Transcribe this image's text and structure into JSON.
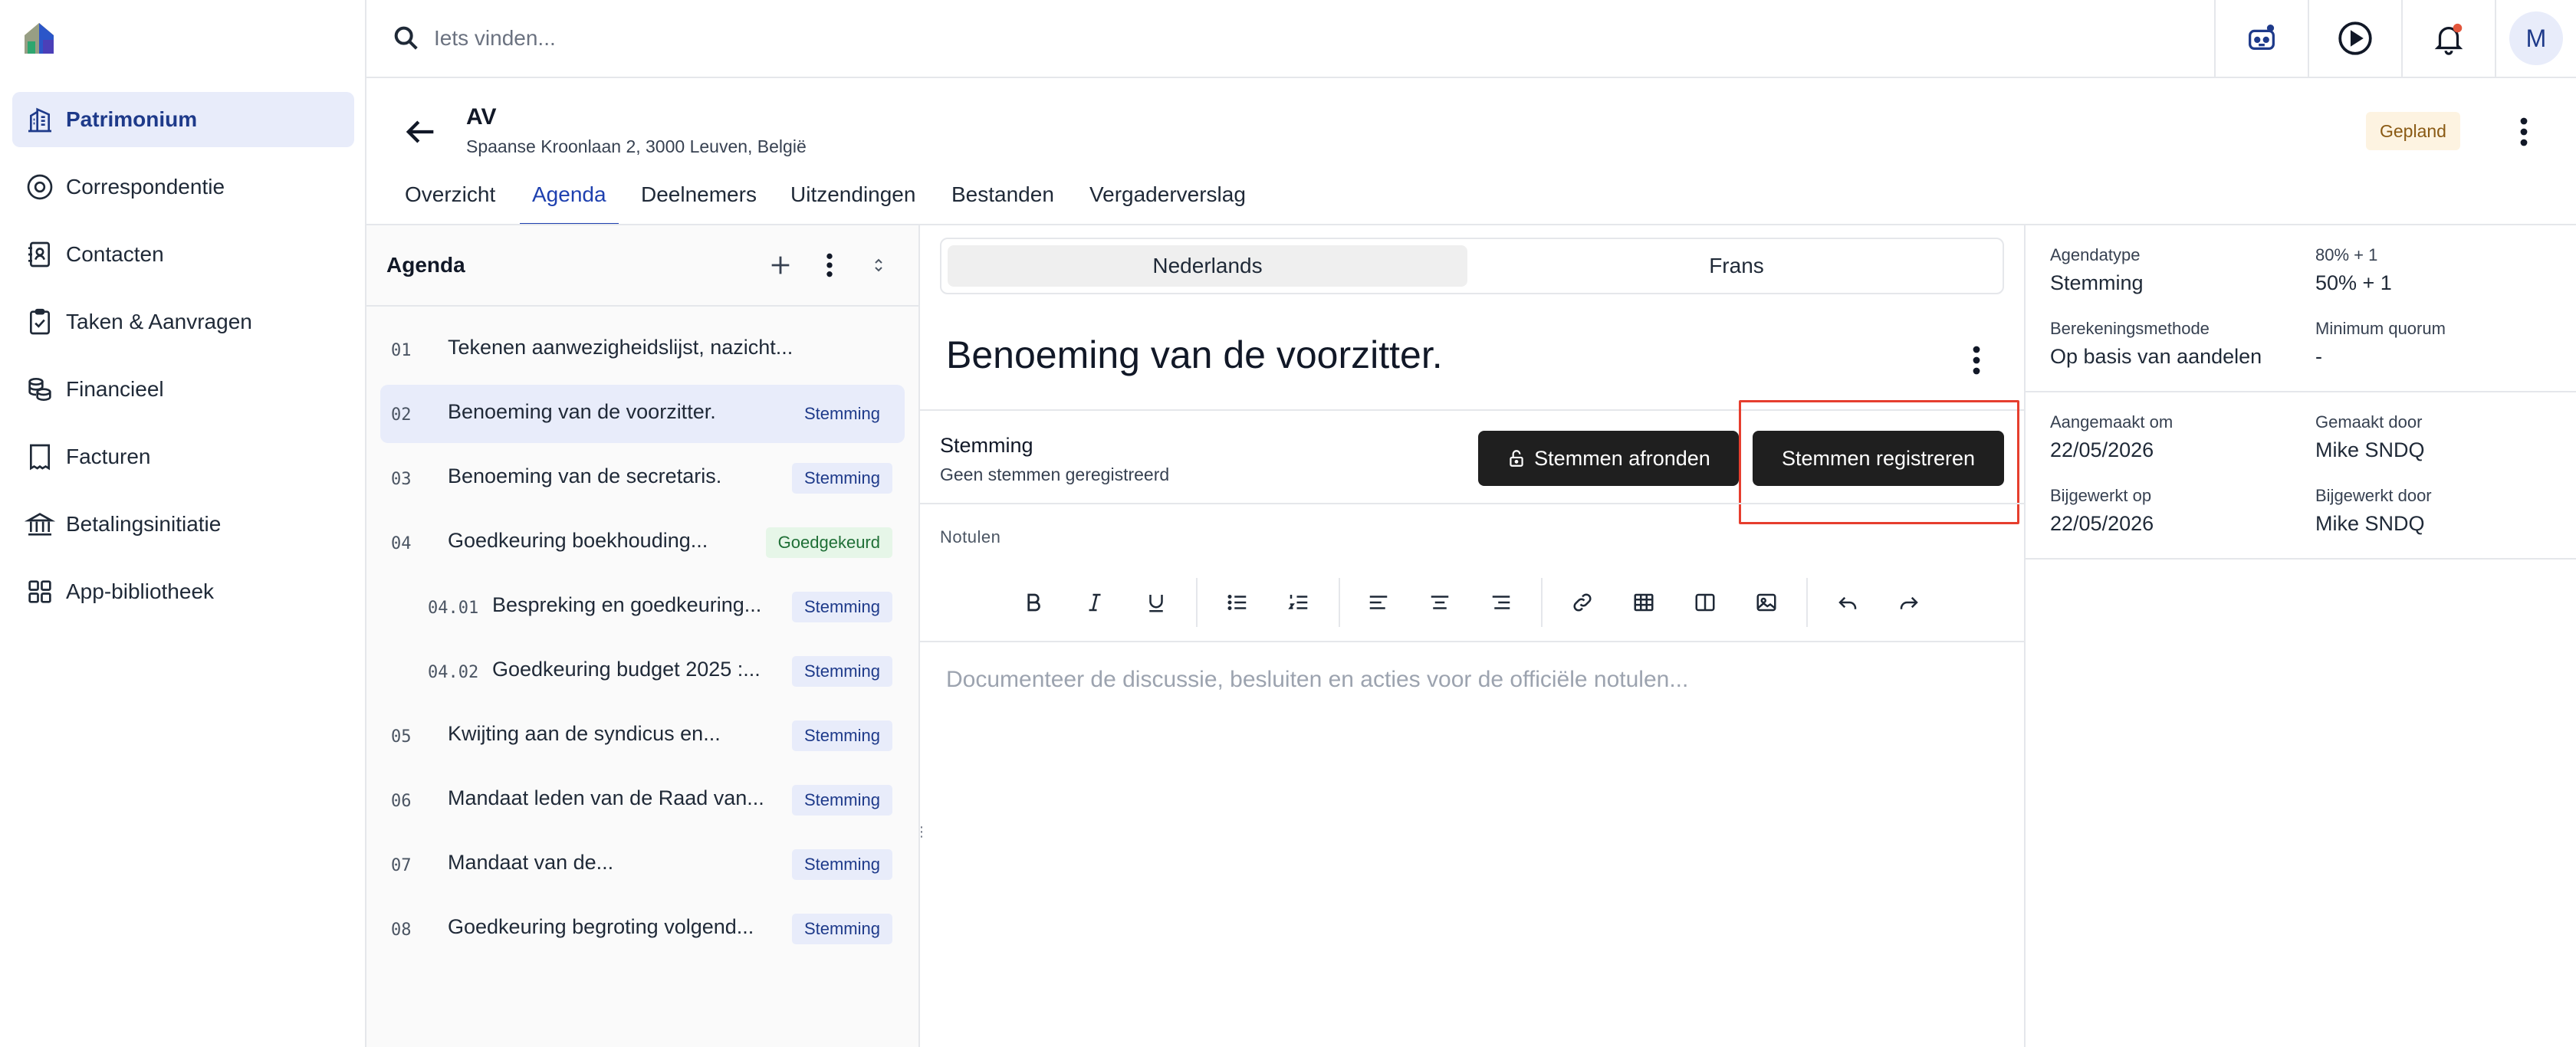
{
  "search": {
    "placeholder": "Iets vinden..."
  },
  "sidebar": {
    "items": [
      {
        "label": "Patrimonium",
        "icon": "building-icon"
      },
      {
        "label": "Correspondentie",
        "icon": "at-sign-icon"
      },
      {
        "label": "Contacten",
        "icon": "contact-book-icon"
      },
      {
        "label": "Taken & Aanvragen",
        "icon": "clipboard-check-icon"
      },
      {
        "label": "Financieel",
        "icon": "coins-icon"
      },
      {
        "label": "Facturen",
        "icon": "invoice-icon"
      },
      {
        "label": "Betalingsinitiatie",
        "icon": "bank-icon"
      },
      {
        "label": "App-bibliotheek",
        "icon": "apps-grid-icon"
      }
    ]
  },
  "topbar": {
    "avatar_initial": "M"
  },
  "header": {
    "title": "AV",
    "address": "Spaanse Kroonlaan 2, 3000 Leuven, België",
    "status": "Gepland"
  },
  "tabs": [
    {
      "label": "Overzicht"
    },
    {
      "label": "Agenda"
    },
    {
      "label": "Deelnemers"
    },
    {
      "label": "Uitzendingen"
    },
    {
      "label": "Bestanden"
    },
    {
      "label": "Vergaderverslag"
    }
  ],
  "agenda": {
    "heading": "Agenda",
    "items": [
      {
        "num": "01",
        "text": "Tekenen aanwezigheidslijst, nazicht...",
        "badge": ""
      },
      {
        "num": "02",
        "text": "Benoeming van de voorzitter.",
        "badge": "Stemming"
      },
      {
        "num": "03",
        "text": "Benoeming van de secretaris.",
        "badge": "Stemming"
      },
      {
        "num": "04",
        "text": "Goedkeuring boekhouding...",
        "badge": "Goedgekeurd"
      },
      {
        "num": "04.01",
        "text": "Bespreking en goedkeuring...",
        "badge": "Stemming"
      },
      {
        "num": "04.02",
        "text": "Goedkeuring budget 2025 :...",
        "badge": "Stemming"
      },
      {
        "num": "05",
        "text": "Kwijting aan de syndicus en...",
        "badge": "Stemming"
      },
      {
        "num": "06",
        "text": "Mandaat leden van de Raad van...",
        "badge": "Stemming"
      },
      {
        "num": "07",
        "text": "Mandaat van de...",
        "badge": "Stemming"
      },
      {
        "num": "08",
        "text": "Goedkeuring begroting volgend...",
        "badge": "Stemming"
      }
    ]
  },
  "detail": {
    "lang_nl": "Nederlands",
    "lang_fr": "Frans",
    "title": "Benoeming van de voorzitter.",
    "vote_label": "Stemming",
    "vote_sub": "Geen stemmen geregistreerd",
    "btn_finish": "Stemmen afronden",
    "btn_register": "Stemmen registreren",
    "notes_label": "Notulen",
    "notes_placeholder": "Documenteer de discussie, besluiten en acties voor de officiële notulen..."
  },
  "meta": {
    "agendatype_label": "Agendatype",
    "agendatype_value": "Stemming",
    "majority_label": "80% + 1",
    "majority_value": "50% + 1",
    "method_label": "Berekeningsmethode",
    "method_value": "Op basis van aandelen",
    "quorum_label": "Minimum quorum",
    "quorum_value": "-",
    "created_label": "Aangemaakt om",
    "created_value": "22/05/2026",
    "created_by_label": "Gemaakt door",
    "created_by_value": "Mike SNDQ",
    "updated_label": "Bijgewerkt op",
    "updated_value": "22/05/2026",
    "updated_by_label": "Bijgewerkt door",
    "updated_by_value": "Mike SNDQ"
  },
  "colors": {
    "accent": "#1e40af",
    "active_bg": "#e8ecfa",
    "dark_button": "#1f1f1f",
    "highlight": "#e63e2e",
    "notification_dot": "#e2553b"
  }
}
